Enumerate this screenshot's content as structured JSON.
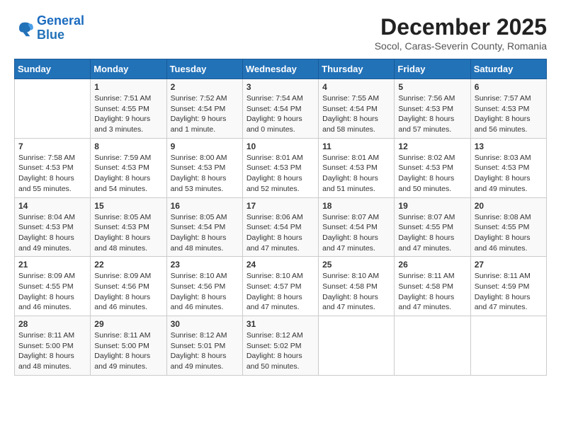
{
  "logo": {
    "line1": "General",
    "line2": "Blue"
  },
  "title": "December 2025",
  "subtitle": "Socol, Caras-Severin County, Romania",
  "days_of_week": [
    "Sunday",
    "Monday",
    "Tuesday",
    "Wednesday",
    "Thursday",
    "Friday",
    "Saturday"
  ],
  "weeks": [
    [
      {
        "day": "",
        "sunrise": "",
        "sunset": "",
        "daylight": ""
      },
      {
        "day": "1",
        "sunrise": "7:51 AM",
        "sunset": "4:55 PM",
        "daylight": "9 hours and 3 minutes."
      },
      {
        "day": "2",
        "sunrise": "7:52 AM",
        "sunset": "4:54 PM",
        "daylight": "9 hours and 1 minute."
      },
      {
        "day": "3",
        "sunrise": "7:54 AM",
        "sunset": "4:54 PM",
        "daylight": "9 hours and 0 minutes."
      },
      {
        "day": "4",
        "sunrise": "7:55 AM",
        "sunset": "4:54 PM",
        "daylight": "8 hours and 58 minutes."
      },
      {
        "day": "5",
        "sunrise": "7:56 AM",
        "sunset": "4:53 PM",
        "daylight": "8 hours and 57 minutes."
      },
      {
        "day": "6",
        "sunrise": "7:57 AM",
        "sunset": "4:53 PM",
        "daylight": "8 hours and 56 minutes."
      }
    ],
    [
      {
        "day": "7",
        "sunrise": "7:58 AM",
        "sunset": "4:53 PM",
        "daylight": "8 hours and 55 minutes."
      },
      {
        "day": "8",
        "sunrise": "7:59 AM",
        "sunset": "4:53 PM",
        "daylight": "8 hours and 54 minutes."
      },
      {
        "day": "9",
        "sunrise": "8:00 AM",
        "sunset": "4:53 PM",
        "daylight": "8 hours and 53 minutes."
      },
      {
        "day": "10",
        "sunrise": "8:01 AM",
        "sunset": "4:53 PM",
        "daylight": "8 hours and 52 minutes."
      },
      {
        "day": "11",
        "sunrise": "8:01 AM",
        "sunset": "4:53 PM",
        "daylight": "8 hours and 51 minutes."
      },
      {
        "day": "12",
        "sunrise": "8:02 AM",
        "sunset": "4:53 PM",
        "daylight": "8 hours and 50 minutes."
      },
      {
        "day": "13",
        "sunrise": "8:03 AM",
        "sunset": "4:53 PM",
        "daylight": "8 hours and 49 minutes."
      }
    ],
    [
      {
        "day": "14",
        "sunrise": "8:04 AM",
        "sunset": "4:53 PM",
        "daylight": "8 hours and 49 minutes."
      },
      {
        "day": "15",
        "sunrise": "8:05 AM",
        "sunset": "4:53 PM",
        "daylight": "8 hours and 48 minutes."
      },
      {
        "day": "16",
        "sunrise": "8:05 AM",
        "sunset": "4:54 PM",
        "daylight": "8 hours and 48 minutes."
      },
      {
        "day": "17",
        "sunrise": "8:06 AM",
        "sunset": "4:54 PM",
        "daylight": "8 hours and 47 minutes."
      },
      {
        "day": "18",
        "sunrise": "8:07 AM",
        "sunset": "4:54 PM",
        "daylight": "8 hours and 47 minutes."
      },
      {
        "day": "19",
        "sunrise": "8:07 AM",
        "sunset": "4:55 PM",
        "daylight": "8 hours and 47 minutes."
      },
      {
        "day": "20",
        "sunrise": "8:08 AM",
        "sunset": "4:55 PM",
        "daylight": "8 hours and 46 minutes."
      }
    ],
    [
      {
        "day": "21",
        "sunrise": "8:09 AM",
        "sunset": "4:55 PM",
        "daylight": "8 hours and 46 minutes."
      },
      {
        "day": "22",
        "sunrise": "8:09 AM",
        "sunset": "4:56 PM",
        "daylight": "8 hours and 46 minutes."
      },
      {
        "day": "23",
        "sunrise": "8:10 AM",
        "sunset": "4:56 PM",
        "daylight": "8 hours and 46 minutes."
      },
      {
        "day": "24",
        "sunrise": "8:10 AM",
        "sunset": "4:57 PM",
        "daylight": "8 hours and 47 minutes."
      },
      {
        "day": "25",
        "sunrise": "8:10 AM",
        "sunset": "4:58 PM",
        "daylight": "8 hours and 47 minutes."
      },
      {
        "day": "26",
        "sunrise": "8:11 AM",
        "sunset": "4:58 PM",
        "daylight": "8 hours and 47 minutes."
      },
      {
        "day": "27",
        "sunrise": "8:11 AM",
        "sunset": "4:59 PM",
        "daylight": "8 hours and 47 minutes."
      }
    ],
    [
      {
        "day": "28",
        "sunrise": "8:11 AM",
        "sunset": "5:00 PM",
        "daylight": "8 hours and 48 minutes."
      },
      {
        "day": "29",
        "sunrise": "8:11 AM",
        "sunset": "5:00 PM",
        "daylight": "8 hours and 49 minutes."
      },
      {
        "day": "30",
        "sunrise": "8:12 AM",
        "sunset": "5:01 PM",
        "daylight": "8 hours and 49 minutes."
      },
      {
        "day": "31",
        "sunrise": "8:12 AM",
        "sunset": "5:02 PM",
        "daylight": "8 hours and 50 minutes."
      },
      {
        "day": "",
        "sunrise": "",
        "sunset": "",
        "daylight": ""
      },
      {
        "day": "",
        "sunrise": "",
        "sunset": "",
        "daylight": ""
      },
      {
        "day": "",
        "sunrise": "",
        "sunset": "",
        "daylight": ""
      }
    ]
  ]
}
